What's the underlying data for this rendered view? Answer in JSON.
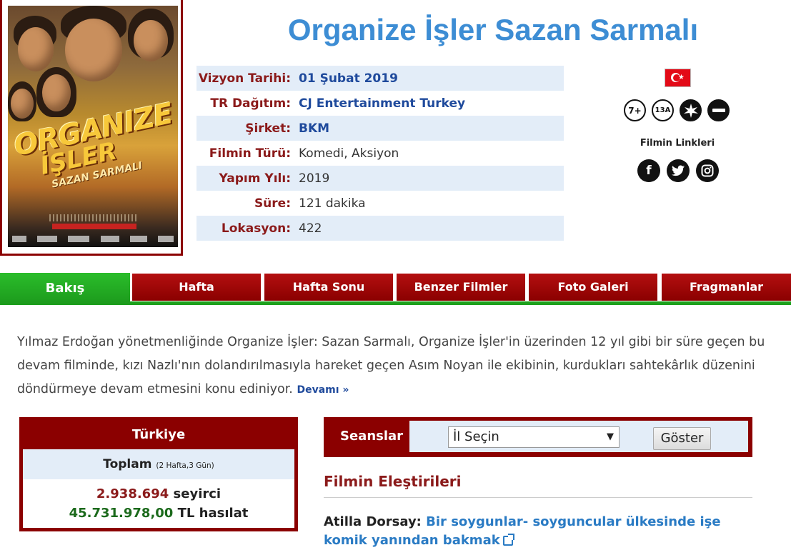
{
  "movie": {
    "title": "Organize İşler Sazan Sarmalı",
    "poster": {
      "art_line1": "ORGANIZE",
      "art_line2": "İŞLER",
      "art_line3": "SAZAN SARMALI"
    }
  },
  "info": {
    "rows": [
      {
        "label": "Vizyon Tarihi:",
        "value": "01 Şubat 2019"
      },
      {
        "label": "TR Dağıtım:",
        "value": "CJ Entertainment Turkey"
      },
      {
        "label": "Şirket:",
        "value": "BKM"
      },
      {
        "label": "Filmin Türü:",
        "value": "Komedi, Aksiyon"
      },
      {
        "label": "Yapım Yılı:",
        "value": "2019"
      },
      {
        "label": "Süre:",
        "value": "121 dakika"
      },
      {
        "label": "Lokasyon:",
        "value": "422"
      }
    ]
  },
  "ratings": {
    "age": "7+",
    "age13": "13A"
  },
  "links": {
    "title": "Filmin Linkleri",
    "facebook": "f",
    "instagram": "◙"
  },
  "tabs": [
    {
      "label": "Bakış",
      "active": true
    },
    {
      "label": "Hafta"
    },
    {
      "label": "Hafta Sonu"
    },
    {
      "label": "Benzer Filmler"
    },
    {
      "label": "Foto Galeri"
    },
    {
      "label": "Fragmanlar"
    }
  ],
  "synopsis": {
    "text": "Yılmaz Erdoğan yönetmenliğinde Organize İşler: Sazan Sarmalı, Organize İşler'in üzerinden 12 yıl gibi bir süre geçen bu devam filminde, kızı Nazlı'nın dolandırılmasıyla hareket geçen Asım Noyan ile ekibinin, kurdukları sahtekârlık düzenini döndürmeye devam etmesini konu ediniyor.",
    "more": "Devamı »"
  },
  "turkiye": {
    "title": "Türkiye",
    "total_label": "Toplam",
    "total_detail": "(2 Hafta,3 Gün)",
    "viewers": "2.938.694",
    "viewers_unit": "seyirci",
    "revenue": "45.731.978,00",
    "revenue_unit": "TL hasılat"
  },
  "seanslar": {
    "label": "Seanslar",
    "select_value": "İl Seçin",
    "button": "Göster"
  },
  "reviews": {
    "title": "Filmin Eleştirileri",
    "items": [
      {
        "author": "Atilla Dorsay:",
        "text": "Bir soygunlar- soyguncular ülkesinde işe komik yanından bakmak"
      }
    ]
  },
  "colors": {
    "accent_blue": "#3d8dd4",
    "dark_red": "#8b0000",
    "tab_green": "#1ca01c"
  }
}
